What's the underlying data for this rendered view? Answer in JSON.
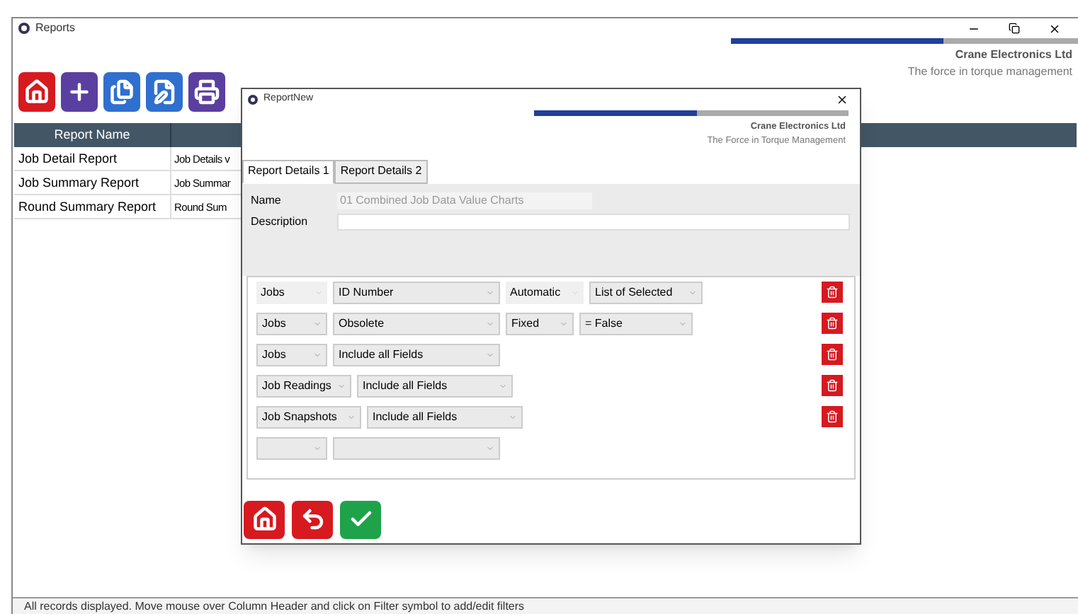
{
  "window": {
    "title": "Reports"
  },
  "branding": {
    "company": "Crane Electronics Ltd",
    "tagline": "The force in torque management"
  },
  "toolbar": [
    {
      "kind": "home",
      "color": "#d71920"
    },
    {
      "kind": "add",
      "color": "#5b3fa0"
    },
    {
      "kind": "copy",
      "color": "#2f6fd0"
    },
    {
      "kind": "edit",
      "color": "#2f6fd0"
    },
    {
      "kind": "print",
      "color": "#5b3fa0"
    }
  ],
  "table": {
    "columns": [
      "Report Name"
    ],
    "rows": [
      [
        "Job Detail Report",
        "Job Details v"
      ],
      [
        "Job Summary Report",
        "Job Summar"
      ],
      [
        "Round Summary Report",
        "Round Sum"
      ]
    ]
  },
  "status_bar": "All records displayed. Move mouse over Column Header and click on Filter symbol to add/edit filters",
  "dialog": {
    "title": "ReportNew",
    "branding": {
      "company": "Crane Electronics Ltd",
      "tagline": "The Force in Torque Management"
    },
    "tabs": [
      {
        "label": "Report Details 1",
        "selected": true
      },
      {
        "label": "Report Details 2",
        "selected": false
      }
    ],
    "name_label": "Name",
    "name_value": "01 Combined Job Data Value Charts",
    "description_label": "Description",
    "filter_rows": [
      {
        "deletable": true,
        "selects": [
          {
            "kind": "flat",
            "value": "Jobs"
          },
          {
            "kind": "dropdown",
            "value": "ID Number"
          },
          {
            "kind": "flat",
            "value": "Automatic"
          },
          {
            "kind": "dropdown",
            "value": "List of Selected"
          }
        ]
      },
      {
        "deletable": true,
        "selects": [
          {
            "kind": "dropdown",
            "value": "Jobs"
          },
          {
            "kind": "dropdown",
            "value": "Obsolete"
          },
          {
            "kind": "dropdown",
            "value": "Fixed"
          },
          {
            "kind": "dropdown",
            "value": "= False"
          }
        ]
      },
      {
        "deletable": true,
        "selects": [
          {
            "kind": "dropdown",
            "value": "Jobs"
          },
          {
            "kind": "dropdown",
            "value": "Include all Fields"
          }
        ]
      },
      {
        "deletable": true,
        "selects": [
          {
            "kind": "dropdown",
            "value": "Job Readings"
          },
          {
            "kind": "dropdown",
            "value": "Include all Fields"
          }
        ]
      },
      {
        "deletable": true,
        "selects": [
          {
            "kind": "dropdown",
            "value": "Job Snapshots"
          },
          {
            "kind": "dropdown",
            "value": "Include all Fields"
          }
        ]
      },
      {
        "deletable": false,
        "selects": [
          {
            "kind": "blank"
          },
          {
            "kind": "blank"
          }
        ]
      }
    ],
    "buttons": [
      {
        "kind": "home",
        "color": "#d71920"
      },
      {
        "kind": "back",
        "color": "#d71920"
      },
      {
        "kind": "ok",
        "color": "#1fa34a"
      }
    ]
  }
}
